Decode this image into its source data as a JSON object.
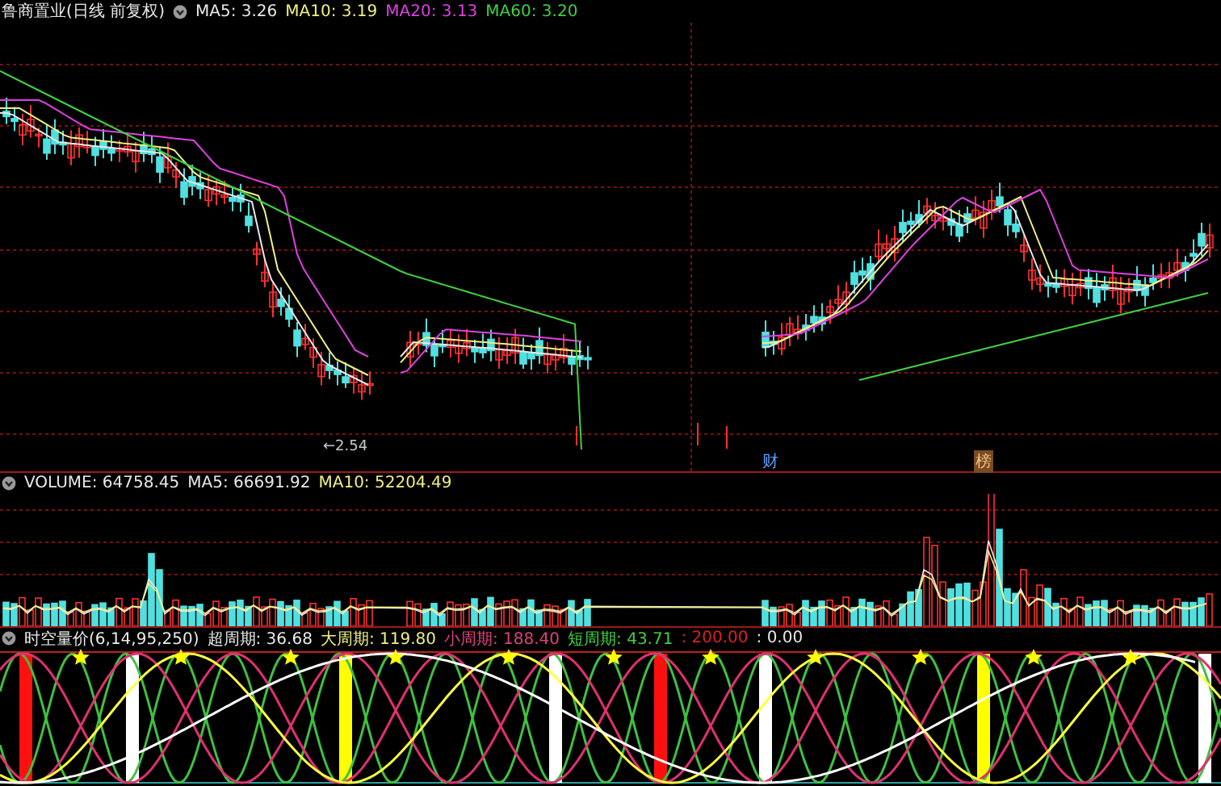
{
  "price_panel": {
    "title": "鲁商置业(日线 前复权)",
    "indicators": [
      {
        "label": "MA5: 3.26",
        "color": "#e8e8e8"
      },
      {
        "label": "MA10: 3.19",
        "color": "#f0f080"
      },
      {
        "label": "MA20: 3.13",
        "color": "#e040e0"
      },
      {
        "label": "MA60: 3.20",
        "color": "#40d040"
      }
    ],
    "low_marker": "←2.54",
    "event_markers": [
      {
        "label": "财",
        "kind": "finance"
      },
      {
        "label": "榜",
        "kind": "ranking"
      }
    ]
  },
  "volume_panel": {
    "indicators": [
      {
        "label": "VOLUME: 64758.45",
        "color": "#e8e8e8"
      },
      {
        "label": "MA5: 66691.92",
        "color": "#e8e8e8"
      },
      {
        "label": "MA10: 52204.49",
        "color": "#f0f080"
      }
    ]
  },
  "indicator_panel": {
    "title": "时空量价(6,14,95,250)",
    "indicators": [
      {
        "label": "超周期: 36.68",
        "color": "#e8e8e8"
      },
      {
        "label": "大周期: 119.80",
        "color": "#f0f080"
      },
      {
        "label": "小周期: 188.40",
        "color": "#e04080"
      },
      {
        "label": "短周期: 43.71",
        "color": "#40d040"
      },
      {
        "label": ": 200.00",
        "color": "#e02020"
      },
      {
        "label": ": 0.00",
        "color": "#e8e8e8"
      }
    ]
  }
}
